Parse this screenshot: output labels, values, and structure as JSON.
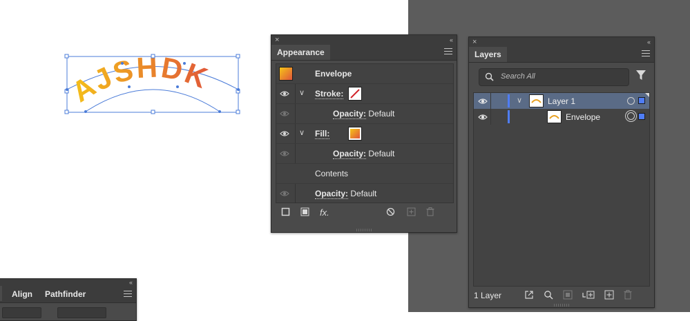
{
  "artwork": {
    "text": "AJSHDK"
  },
  "appearance": {
    "close_glyph": "×",
    "collapse_glyph": "‹‹",
    "tab_label": "Appearance",
    "object_name": "Envelope",
    "rows": [
      {
        "label": "Stroke:"
      },
      {
        "opacity_label": "Opacity:",
        "opacity_value": "Default"
      },
      {
        "label": "Fill:"
      },
      {
        "opacity_label": "Opacity:",
        "opacity_value": "Default"
      },
      {
        "label": "Contents"
      },
      {
        "opacity_label": "Opacity:",
        "opacity_value": "Default"
      }
    ],
    "fx_label": "fx."
  },
  "layers": {
    "close_glyph": "×",
    "collapse_glyph": "‹‹",
    "tab_label": "Layers",
    "search_placeholder": "Search All",
    "items": [
      {
        "name": "Layer 1"
      },
      {
        "name": "Envelope"
      }
    ],
    "footer_count": "1 Layer"
  },
  "align_panel": {
    "collapse_glyph": "‹‹",
    "tabs": [
      "Align",
      "Pathfinder"
    ]
  },
  "colors": {
    "accent": "#4f7df5",
    "selection_row": "#5a6b86",
    "panel_bg": "#4a4a4a",
    "canvas_dark": "#5c5c5c",
    "gradient_start": "#f5c518",
    "gradient_end": "#e0553a"
  }
}
